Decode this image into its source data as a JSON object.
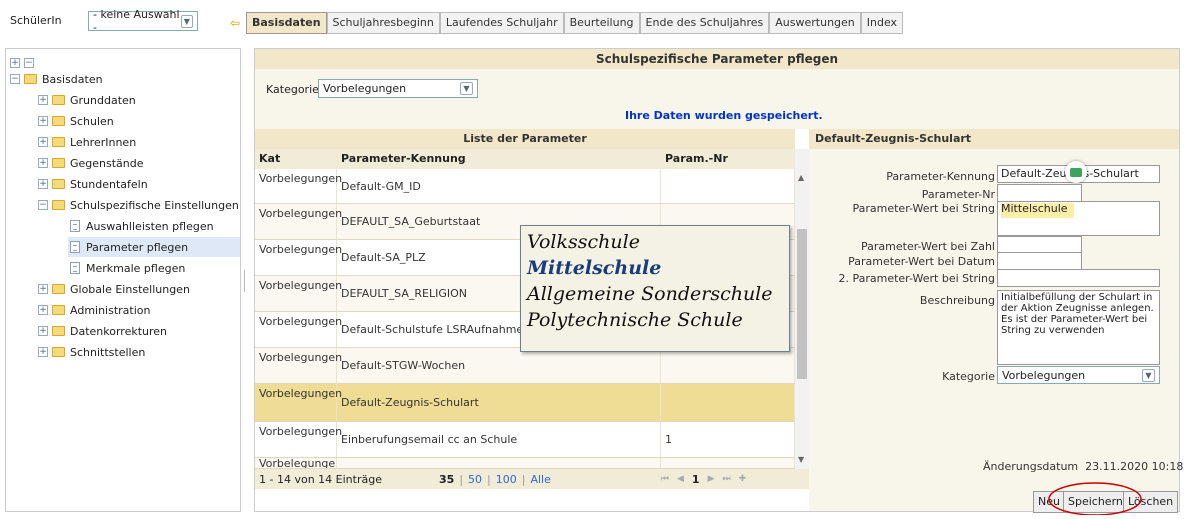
{
  "topbar": {
    "student_label": "SchülerIn",
    "student_select": "- keine Auswahl -",
    "tabs": [
      "Basisdaten",
      "Schuljahresbeginn",
      "Laufendes Schuljahr",
      "Beurteilung",
      "Ende des Schuljahres",
      "Auswertungen",
      "Index"
    ]
  },
  "tree": {
    "items": [
      {
        "label": "Basisdaten"
      },
      {
        "label": "Grunddaten"
      },
      {
        "label": "Schulen"
      },
      {
        "label": "LehrerInnen"
      },
      {
        "label": "Gegenstände"
      },
      {
        "label": "Stundentafeln"
      },
      {
        "label": "Schulspezifische Einstellungen"
      },
      {
        "label": "Auswahlleisten pflegen"
      },
      {
        "label": "Parameter pflegen"
      },
      {
        "label": "Merkmale pflegen"
      },
      {
        "label": "Globale Einstellungen"
      },
      {
        "label": "Administration"
      },
      {
        "label": "Datenkorrekturen"
      },
      {
        "label": "Schnittstellen"
      }
    ]
  },
  "main": {
    "title": "Schulspezifische Parameter pflegen",
    "category_label": "Kategorie",
    "category_value": "Vorbelegungen",
    "saved_message": "Ihre Daten wurden gespeichert.",
    "list_title": "Liste der Parameter",
    "columns": [
      "Kat",
      "Parameter-Kennung",
      "Param.-Nr"
    ],
    "rows": [
      {
        "kat": "Vorbelegungen",
        "kennung": "Default-GM_ID",
        "nr": ""
      },
      {
        "kat": "Vorbelegungen",
        "kennung": "DEFAULT_SA_Geburtstaat",
        "nr": ""
      },
      {
        "kat": "Vorbelegungen",
        "kennung": "Default-SA_PLZ",
        "nr": ""
      },
      {
        "kat": "Vorbelegungen",
        "kennung": "DEFAULT_SA_RELIGION",
        "nr": ""
      },
      {
        "kat": "Vorbelegungen",
        "kennung": "Default-Schulstufe LSRAufnahme",
        "nr": ""
      },
      {
        "kat": "Vorbelegungen",
        "kennung": "Default-STGW-Wochen",
        "nr": ""
      },
      {
        "kat": "Vorbelegungen",
        "kennung": "Default-Zeugnis-Schulart",
        "nr": ""
      },
      {
        "kat": "Vorbelegungen",
        "kennung": "Einberufungsemail cc an Schule",
        "nr": "1"
      },
      {
        "kat": "Vorbelegunge",
        "kennung": "",
        "nr": ""
      }
    ],
    "pager": {
      "info": "1 - 14 von 14 Einträge",
      "sizes": [
        "35",
        "50",
        "100",
        "Alle"
      ],
      "page": "1"
    }
  },
  "popup": {
    "lines": [
      "Volksschule",
      "Mittelschule",
      "Allgemeine Sonderschule",
      "Polytechnische Schule"
    ]
  },
  "form": {
    "title": "Default-Zeugnis-Schulart",
    "labels": {
      "kennung": "Parameter-Kennung",
      "nr": "Parameter-Nr",
      "string": "Parameter-Wert bei String",
      "zahl": "Parameter-Wert bei Zahl",
      "datum": "Parameter-Wert bei Datum",
      "string2": "2. Parameter-Wert bei String",
      "beschreibung": "Beschreibung",
      "kategorie": "Kategorie"
    },
    "values": {
      "kennung": "Default-Zeugnis-Schulart",
      "nr": "",
      "string": "Mittelschule",
      "zahl": "",
      "datum": "",
      "string2": "",
      "beschreibung": "Initialbefüllung der Schulart in der Aktion Zeugnisse anlegen. Es ist der Parameter-Wert bei String zu verwenden",
      "kategorie": "Vorbelegungen"
    },
    "change_date": "Änderungsdatum  23.11.2020 10:18",
    "buttons": {
      "neu": "Neu",
      "speichern": "Speichern",
      "loeschen": "Löschen"
    }
  },
  "colors": {
    "header_bg": "#f3e7c9",
    "highlight": "#fbeea8",
    "link": "#0033cc",
    "annotation": "#cc0000"
  }
}
